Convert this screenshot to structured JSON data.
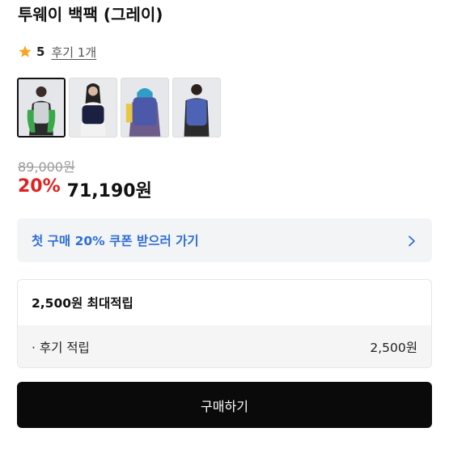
{
  "product": {
    "title": "투웨이 백팩 (그레이)",
    "rating": {
      "score": "5",
      "review_link": "후기 1개"
    },
    "thumbnails": [
      {
        "label": "gray-backpack-photo-1",
        "selected": true
      },
      {
        "label": "navy-backpack-photo-2",
        "selected": false
      },
      {
        "label": "blue-backpack-photo-3",
        "selected": false
      },
      {
        "label": "blue-backpack-photo-4",
        "selected": false
      }
    ],
    "price": {
      "original": "89,000원",
      "discount": "20%",
      "sale": "71,190원"
    }
  },
  "coupon": {
    "text": "첫 구매 20% 쿠폰 받으러 가기",
    "icon": "chevron-right-icon"
  },
  "points": {
    "header": "2,500원 최대적립",
    "row_label": "· 후기 적립",
    "row_value": "2,500원"
  },
  "actions": {
    "buy_label": "구매하기"
  },
  "colors": {
    "discount": "#e02020",
    "coupon_text": "#2f6fd8",
    "star": "#f5a623",
    "button": "#0a0a0a"
  }
}
